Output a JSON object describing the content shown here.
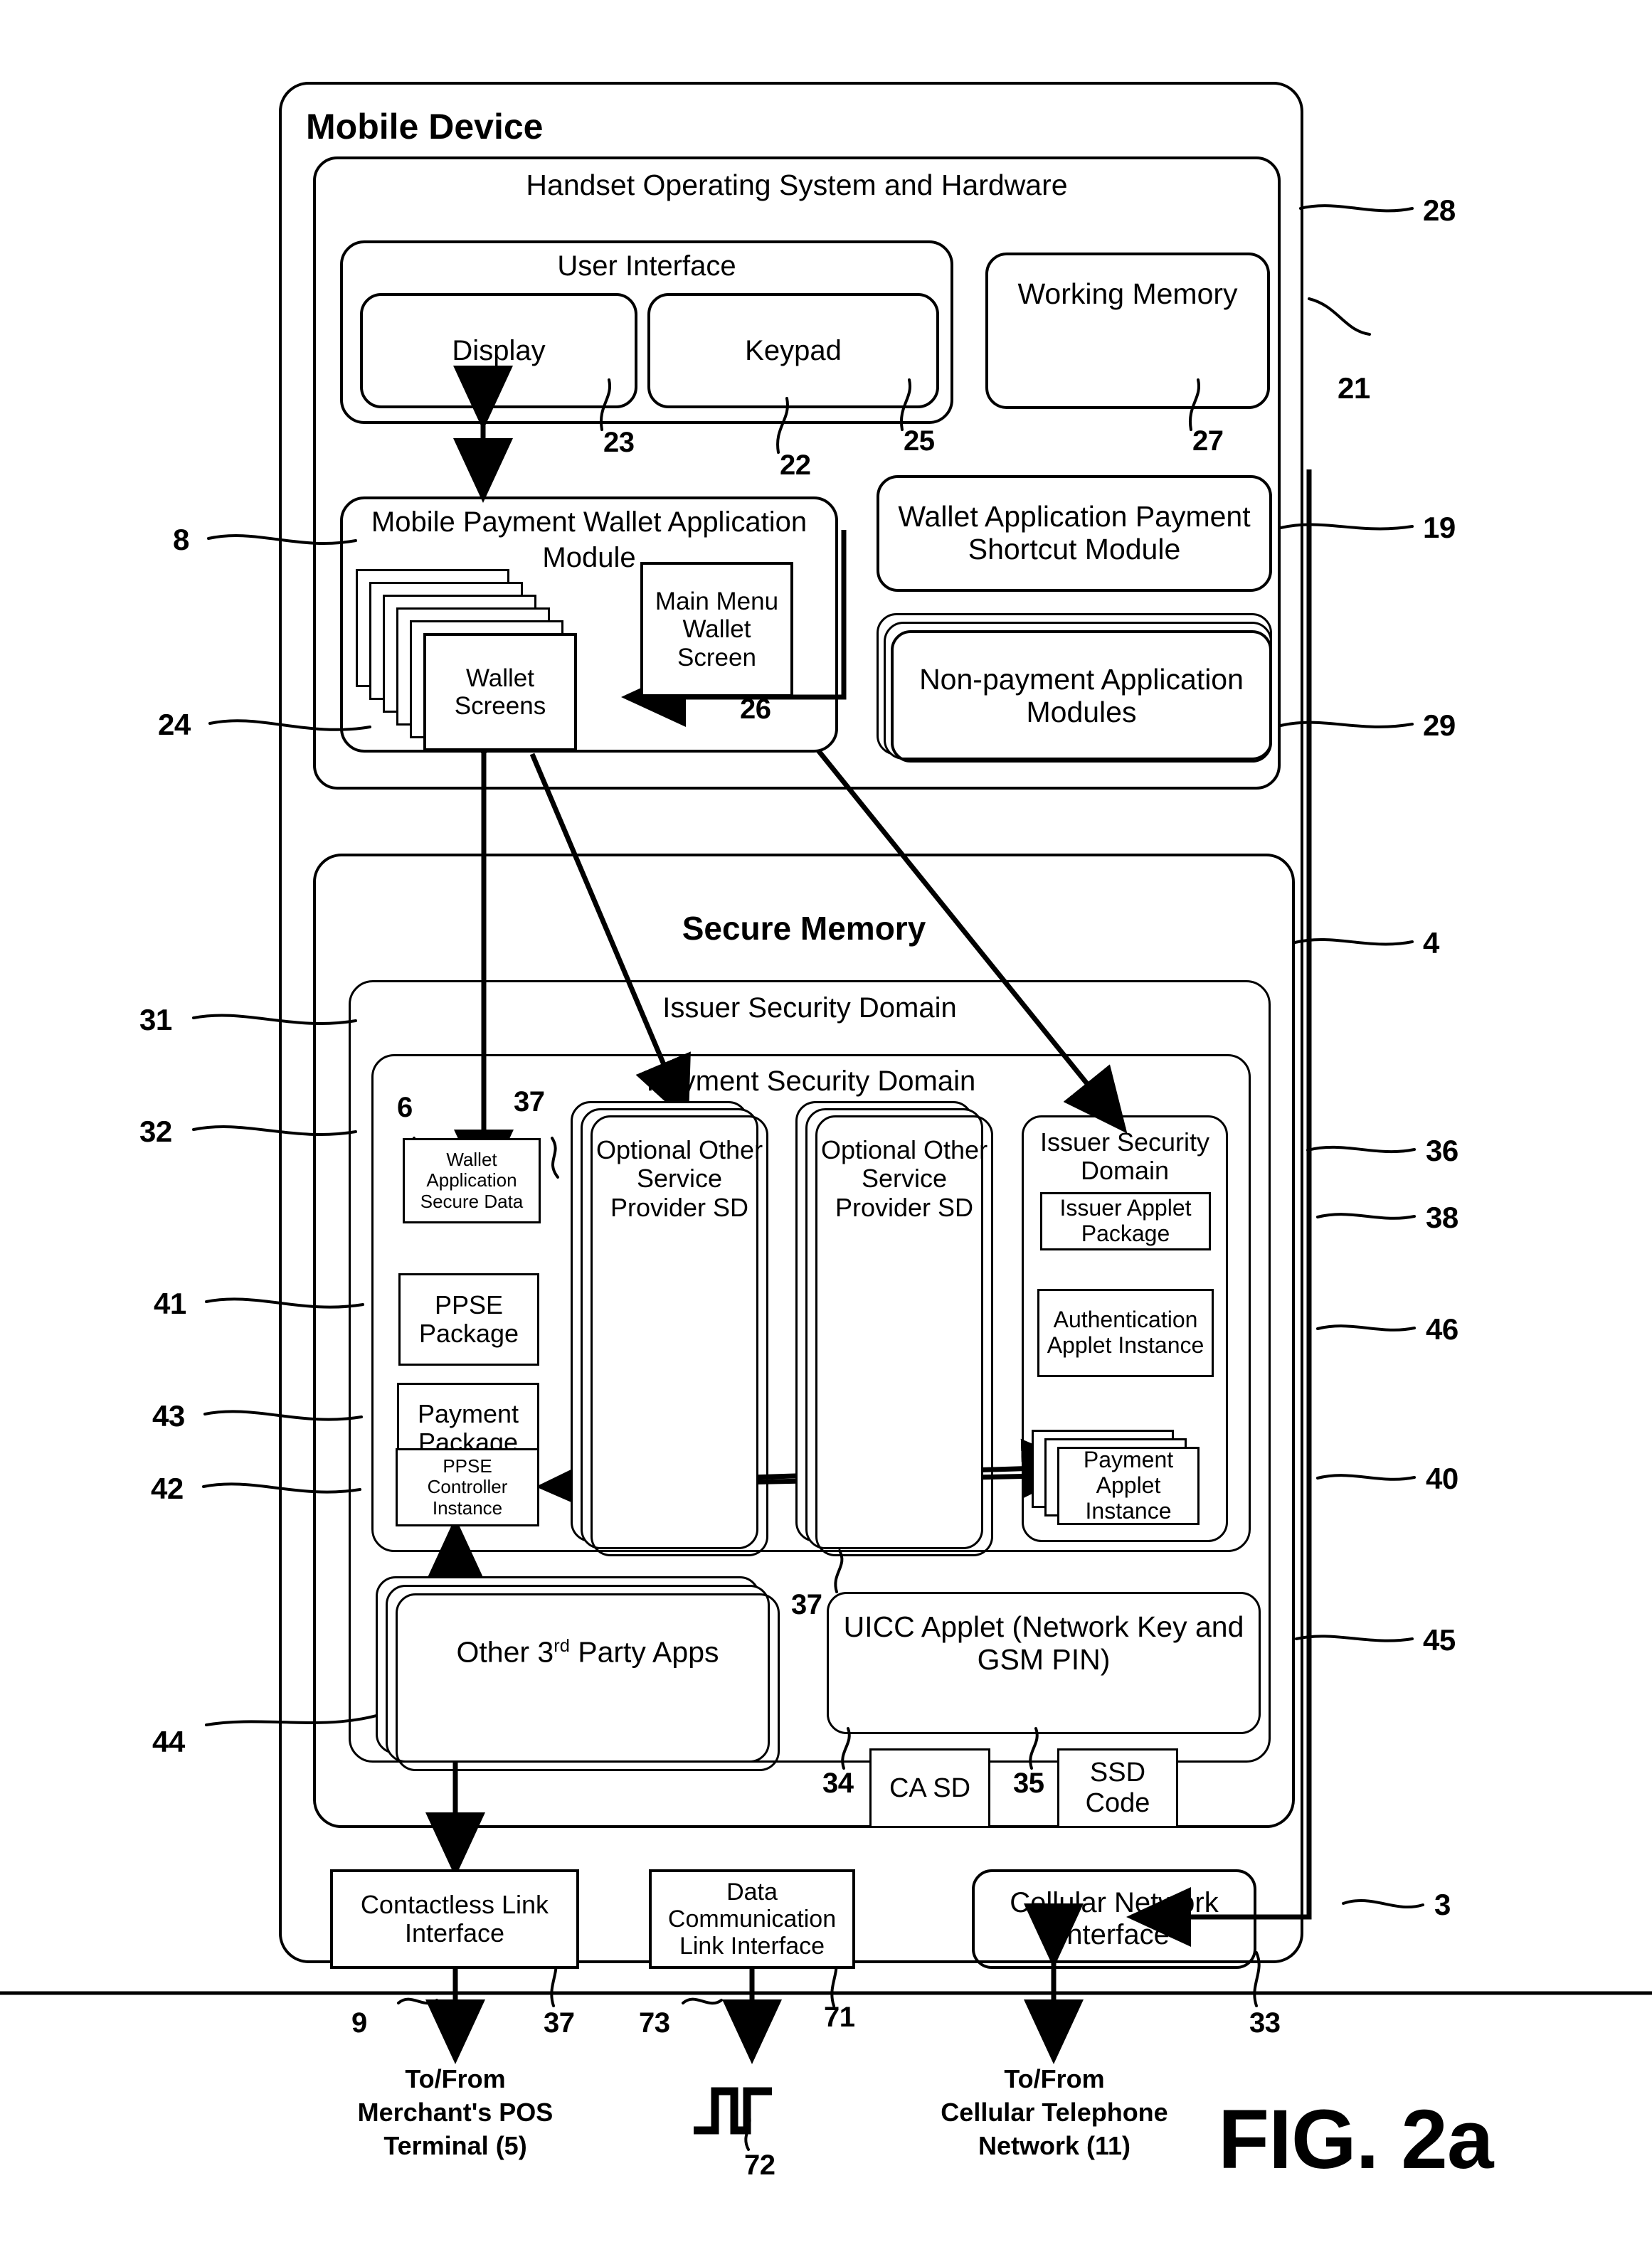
{
  "figure": {
    "label": "FIG. 2a"
  },
  "device": {
    "title": "Mobile Device",
    "ref": "8"
  },
  "handset": {
    "title": "Handset Operating System and Hardware",
    "ref": "28",
    "ref_ui_side": "21"
  },
  "user_interface": {
    "title": "User Interface",
    "ref": "22",
    "display": {
      "label": "Display",
      "ref": "23"
    },
    "keypad": {
      "label": "Keypad",
      "ref": "25"
    }
  },
  "working_memory": {
    "label": "Working Memory",
    "ref": "27"
  },
  "wallet_app": {
    "title": "Mobile Payment Wallet Application Module",
    "title_line1": "Mobile Payment Wallet Application",
    "title_line2": "Module",
    "ref": "24",
    "main_menu_screen": {
      "label": "Main Menu\nWallet\nScreen",
      "ref": "26"
    },
    "wallet_screens": {
      "label": "Wallet\nScreens"
    }
  },
  "shortcut_module": {
    "label": "Wallet Application\nPayment Shortcut Module",
    "ref": "19"
  },
  "nonpayment_modules": {
    "label": "Non-payment Application\nModules",
    "ref": "29"
  },
  "secure_memory": {
    "title": "Secure Memory",
    "ref": "4"
  },
  "issuer_security_domain_outer": {
    "title": "Issuer Security Domain",
    "ref": "31"
  },
  "payment_security_domain": {
    "title": "Payment Security Domain",
    "ref": "32"
  },
  "wallet_secure_data": {
    "label": "Wallet\nApplication\nSecure Data",
    "ref": "6"
  },
  "ppse_package": {
    "label": "PPSE\nPackage",
    "ref": "41"
  },
  "payment_package": {
    "label": "Payment\nPackage",
    "ref": "43"
  },
  "ppse_controller": {
    "label": "PPSE\nController\nInstance",
    "ref": "42"
  },
  "other_sd_1": {
    "label": "Optional\nOther Service\nProvider SD",
    "ref": "37"
  },
  "other_sd_2": {
    "label": "Optional\nOther Service\nProvider SD",
    "ref": "37"
  },
  "issuer_security_domain_inner": {
    "title": "Issuer Security\nDomain",
    "ref": "36",
    "issuer_applet_package": {
      "label": "Issuer Applet\nPackage",
      "ref": "38"
    },
    "authentication_applet": {
      "label": "Authentication\nApplet\nInstance",
      "ref": "46"
    },
    "payment_applet": {
      "label": "Payment\nApplet\nInstance",
      "ref": "40"
    }
  },
  "third_party_apps": {
    "label": "Other 3rd Party Apps",
    "label_pre": "Other 3",
    "label_sup": "rd",
    "label_post": " Party Apps",
    "ref": "44"
  },
  "uicc_applet": {
    "label": "UICC Applet (Network Key\nand GSM PIN)",
    "ref": "45"
  },
  "ca_sd": {
    "label": "CA SD",
    "ref": "34"
  },
  "ssd_code": {
    "label": "SSD\nCode",
    "ref": "35"
  },
  "interfaces": {
    "contactless": {
      "label": "Contactless Link\nInterface",
      "ref": "37",
      "ref_left": "9"
    },
    "data_comm": {
      "label": "Data\nCommunication\nLink Interface",
      "ref": "71",
      "ref_left": "73"
    },
    "cellular": {
      "label": "Cellular Network\nInterface",
      "ref": "33",
      "ref_right": "3"
    }
  },
  "captions": {
    "merchant": "To/From\nMerchant's POS\nTerminal (5)",
    "waveform_ref": "72",
    "cellular": "To/From\nCellular Telephone\nNetwork (11)"
  }
}
